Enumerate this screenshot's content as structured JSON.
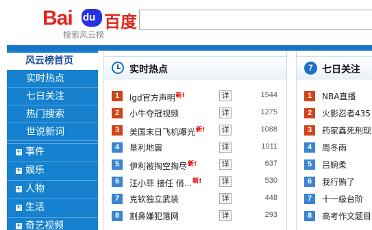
{
  "header": {
    "logo_latin": "Bai",
    "logo_paw": "du",
    "logo_cn": "百度",
    "logo_sub": "搜索风云榜",
    "search_value": ""
  },
  "sidebar": {
    "selected": "风云榜首页",
    "subitems": [
      "实时热点",
      "七日关注",
      "热门搜索",
      "世说新词"
    ],
    "categories": [
      "事件",
      "娱乐",
      "人物",
      "生活",
      "奇艺视频"
    ],
    "expand_icon": "plus-icon"
  },
  "realtime": {
    "title": "实时热点",
    "icon": "clock-icon",
    "detail_label": "详",
    "new_label": "新!",
    "items": [
      {
        "rank": "1",
        "text": "lgd官方声明",
        "new": true,
        "count": "1544"
      },
      {
        "rank": "2",
        "text": "小牛夺冠视频",
        "new": false,
        "count": "1275"
      },
      {
        "rank": "3",
        "text": "美国末日飞机曝光",
        "new": true,
        "count": "1088"
      },
      {
        "rank": "4",
        "text": "垦利地震",
        "new": false,
        "count": "1011"
      },
      {
        "rank": "5",
        "text": "伊利被掏空掏尽",
        "new": true,
        "count": "637"
      },
      {
        "rank": "6",
        "text": "汪小菲 接任 俏...",
        "new": true,
        "count": "530"
      },
      {
        "rank": "7",
        "text": "克钦独立武装",
        "new": false,
        "count": "448"
      },
      {
        "rank": "8",
        "text": "割鼻嫌犯落网",
        "new": false,
        "count": "293"
      }
    ]
  },
  "weekly": {
    "title": "七日关注",
    "icon_label": "7",
    "items": [
      {
        "rank": "1",
        "text": "NBA直播"
      },
      {
        "rank": "2",
        "text": "火影忍者435"
      },
      {
        "rank": "3",
        "text": "药家鑫死刑现"
      },
      {
        "rank": "4",
        "text": "周冬雨"
      },
      {
        "rank": "5",
        "text": "吕婉柔"
      },
      {
        "rank": "6",
        "text": "我行贿了"
      },
      {
        "rank": "7",
        "text": "十一级台阶"
      },
      {
        "rank": "8",
        "text": "高考作文题目"
      }
    ]
  },
  "colors": {
    "brand_red": "#e1251b",
    "brand_blue": "#2932e1",
    "sidebar_blue": "#1581cf",
    "rank_hot": "#d3431b",
    "rank_normal": "#3c85d2"
  }
}
